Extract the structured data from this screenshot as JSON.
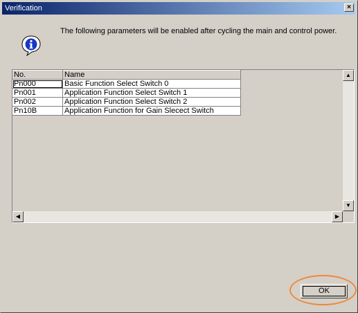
{
  "window": {
    "title": "Verification",
    "close_glyph": "×"
  },
  "message": "The following parameters will be enabled after cycling the main and control power.",
  "table": {
    "headers": [
      "No.",
      "Name"
    ],
    "rows": [
      [
        "Pn000",
        "Basic Function Select Switch 0"
      ],
      [
        "Pn001",
        "Application Function Select Switch 1"
      ],
      [
        "Pn002",
        "Application Function Select Switch 2"
      ],
      [
        "Pn10B",
        "Application Function for Gain Slecect Switch"
      ]
    ]
  },
  "buttons": {
    "ok": "OK"
  },
  "icons": {
    "info": "info-icon",
    "close": "close-icon"
  },
  "colors": {
    "title_start": "#0a246a",
    "title_end": "#a6caf0",
    "highlight": "#f0883a",
    "dialog_bg": "#d4d0c8"
  }
}
